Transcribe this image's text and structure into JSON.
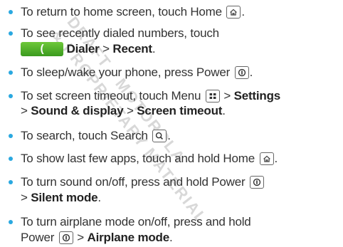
{
  "watermark": {
    "line1": "DRAFT - MOTOROLA",
    "line2": "& PROPRIETARY MATERIAL"
  },
  "tips": [
    {
      "text_before": "To return to home screen, touch Home",
      "icon": "home-key-icon"
    },
    {
      "text_before": "To see recently dialed numbers, touch",
      "dialer_glyph": "(",
      "bold1": "Dialer",
      "sep1": " > ",
      "bold2": "Recent",
      "end": "."
    },
    {
      "text_before": "To sleep/wake your phone, press Power",
      "icon": "power-key-icon",
      "end": "."
    },
    {
      "text_before": "To set screen timeout, touch Menu",
      "icon": "menu-key-icon",
      "sep0": " > ",
      "bold1": "Settings",
      "sep1": "> ",
      "bold2": "Sound & display",
      "sep2": " > ",
      "bold3": "Screen timeout",
      "end": "."
    },
    {
      "text_before": "To search, touch Search",
      "icon": "search-key-icon",
      "end": "."
    },
    {
      "text_before": "To show last few apps, touch and hold Home",
      "icon": "home-key-icon",
      "end": "."
    },
    {
      "text_before": "To turn sound on/off, press and hold Power",
      "icon": "power-key-icon",
      "sep1": "> ",
      "bold1": "Silent mode",
      "end": "."
    },
    {
      "text_before": "To turn airplane mode on/off, press and hold",
      "line2_before": "Power",
      "icon": "power-key-icon",
      "sep1": " > ",
      "bold1": "Airplane mode",
      "end": "."
    }
  ],
  "colors": {
    "bullet": "#2aa8e0",
    "dialer_button": "#4caf2a"
  }
}
